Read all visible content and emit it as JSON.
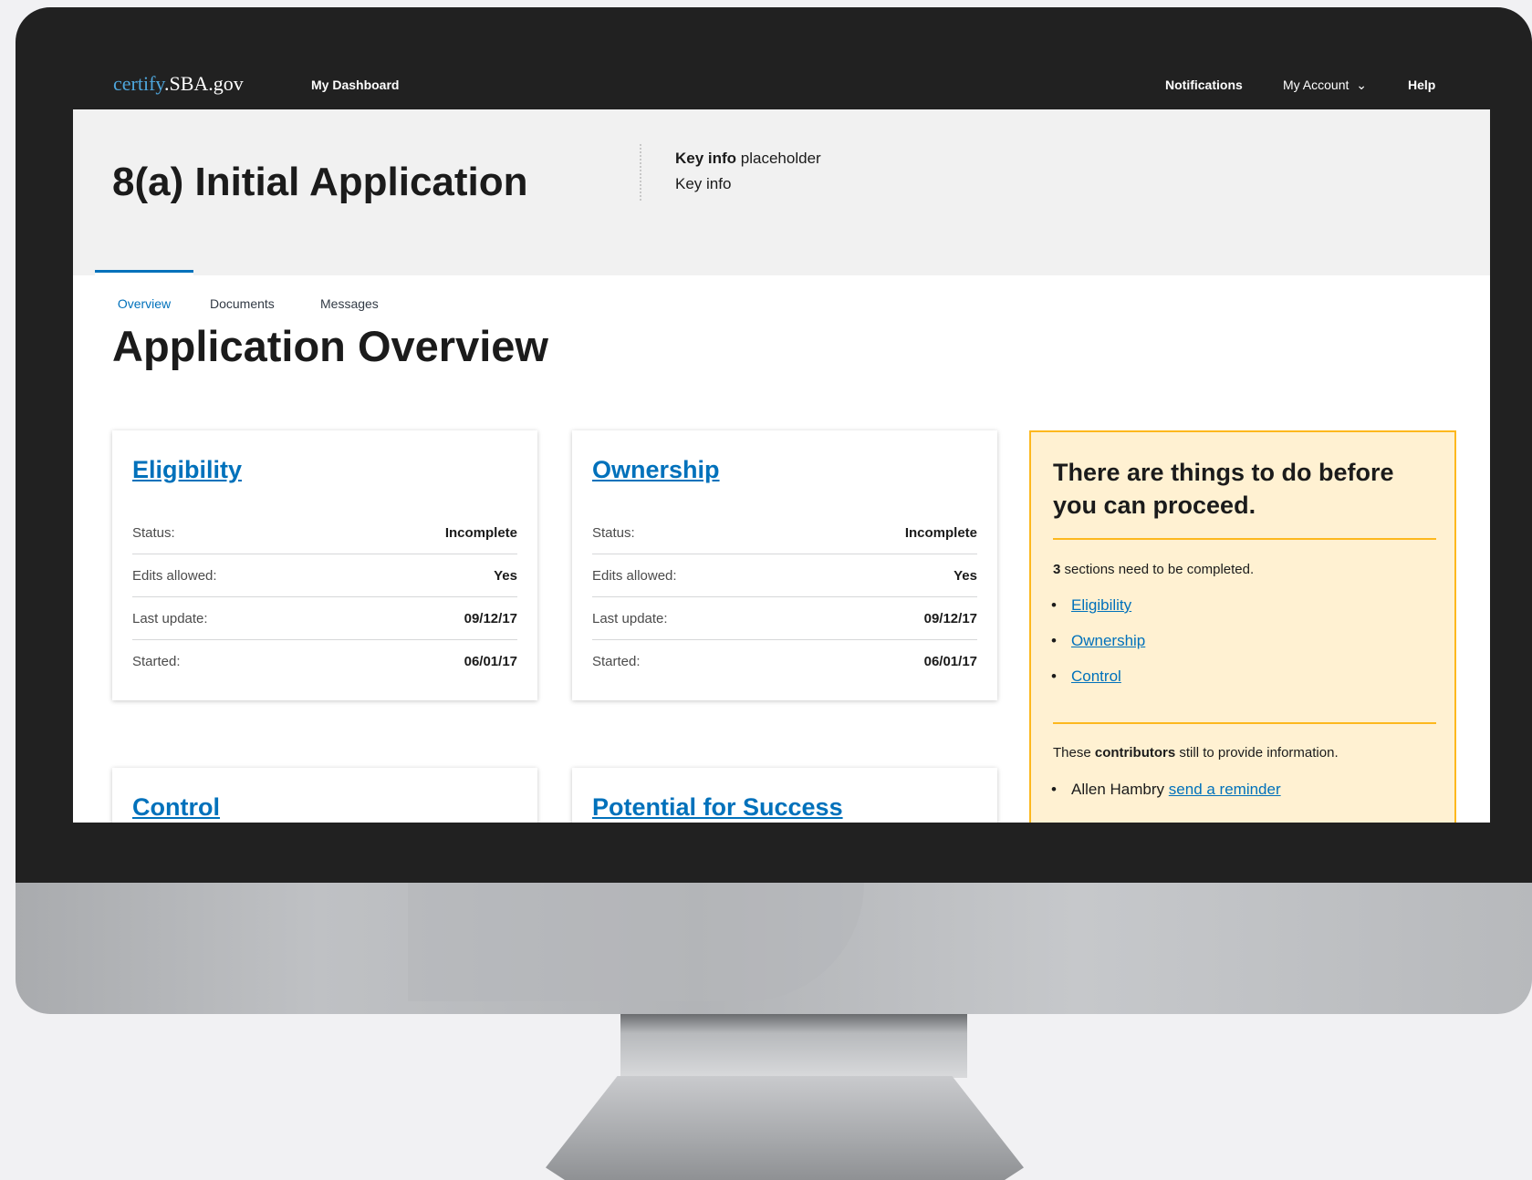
{
  "nav": {
    "logo_part1": "certify",
    "logo_part2": ".SBA.gov",
    "dashboard": "My Dashboard",
    "notifications": "Notifications",
    "account": "My Account",
    "account_caret": "⌄",
    "help": "Help"
  },
  "header": {
    "title": "8(a) Initial Application",
    "keyinfo_label_bold": "Key info",
    "keyinfo_label_rest": " placeholder",
    "keyinfo_value": "Key info"
  },
  "tabs": [
    {
      "label": "Overview",
      "active": true
    },
    {
      "label": "Documents",
      "active": false
    },
    {
      "label": "Messages",
      "active": false
    }
  ],
  "main": {
    "title": "Application Overview",
    "cards": [
      {
        "title": "Eligibility",
        "rows": [
          {
            "label": "Status:",
            "value": "Incomplete"
          },
          {
            "label": "Edits allowed:",
            "value": "Yes"
          },
          {
            "label": "Last update:",
            "value": "09/12/17"
          },
          {
            "label": "Started:",
            "value": "06/01/17"
          }
        ]
      },
      {
        "title": "Ownership",
        "rows": [
          {
            "label": "Status:",
            "value": "Incomplete"
          },
          {
            "label": "Edits allowed:",
            "value": "Yes"
          },
          {
            "label": "Last update:",
            "value": "09/12/17"
          },
          {
            "label": "Started:",
            "value": "06/01/17"
          }
        ]
      },
      {
        "title": "Control"
      },
      {
        "title": "Potential for Success"
      }
    ]
  },
  "alert": {
    "title": "There are things to do before you can proceed.",
    "sections_count": "3",
    "sections_text": " sections need to be completed.",
    "sections": [
      "Eligibility",
      "Ownership",
      "Control"
    ],
    "contrib_pre": "These ",
    "contrib_bold": "contributors",
    "contrib_post": " still to provide information.",
    "contributor_name": "Allen Hambry",
    "reminder_link": "send a reminder"
  },
  "colors": {
    "link": "#0071bb",
    "alert_bg": "#fff1d2",
    "alert_border": "#fdb81e",
    "topbar": "#212121"
  }
}
